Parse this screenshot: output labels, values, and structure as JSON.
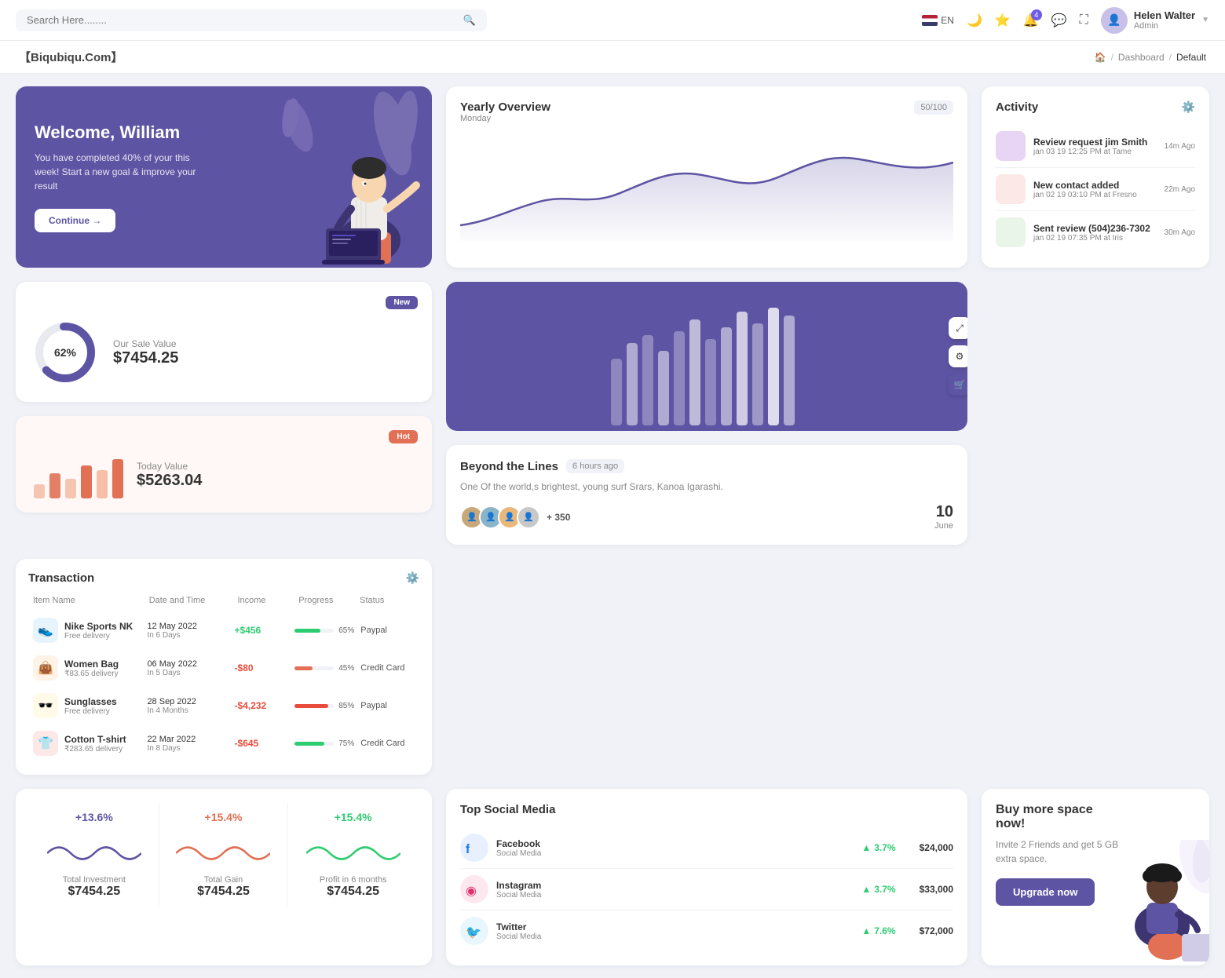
{
  "topnav": {
    "search_placeholder": "Search Here........",
    "lang": "EN",
    "notif_count": "4",
    "user_name": "Helen Walter",
    "user_role": "Admin"
  },
  "breadcrumb": {
    "brand": "【Biqubiqu.Com】",
    "home": "🏠",
    "dashboard": "Dashboard",
    "current": "Default"
  },
  "welcome": {
    "title": "Welcome, William",
    "subtitle": "You have completed 40% of your this week! Start a new goal & improve your result",
    "button": "Continue →"
  },
  "yearly": {
    "title": "Yearly Overview",
    "subtitle": "Monday",
    "badge": "50/100"
  },
  "activity": {
    "title": "Activity",
    "items": [
      {
        "title": "Review request jim Smith",
        "sub": "jan 03 19 12:25 PM at Tame",
        "time": "14m Ago",
        "color": "#e8d5f5"
      },
      {
        "title": "New contact added",
        "sub": "jan 02 19 03:10 PM at Fresno",
        "time": "22m Ago",
        "color": "#fde8e8"
      },
      {
        "title": "Sent review (504)236-7302",
        "sub": "jan 02 19 07:35 PM at Iris",
        "time": "30m Ago",
        "color": "#e8f5e8"
      }
    ]
  },
  "transaction": {
    "title": "Transaction",
    "headers": [
      "Item Name",
      "Date and Time",
      "Income",
      "Progress",
      "Status"
    ],
    "rows": [
      {
        "name": "Nike Sports NK",
        "sub": "Free delivery",
        "date": "12 May 2022",
        "days": "In 6 Days",
        "income": "+$456",
        "income_type": "pos",
        "progress": 65,
        "status": "Paypal",
        "icon": "👟",
        "icon_bg": "#e8f4fd",
        "bar_color": "#2ecc71"
      },
      {
        "name": "Women Bag",
        "sub": "₹83.65 delivery",
        "date": "06 May 2022",
        "days": "In 5 Days",
        "income": "-$80",
        "income_type": "neg",
        "progress": 45,
        "status": "Credit Card",
        "icon": "👜",
        "icon_bg": "#fff3e8",
        "bar_color": "#e17055"
      },
      {
        "name": "Sunglasses",
        "sub": "Free delivery",
        "date": "28 Sep 2022",
        "days": "In 4 Months",
        "income": "-$4,232",
        "income_type": "neg",
        "progress": 85,
        "status": "Paypal",
        "icon": "🕶️",
        "icon_bg": "#fffbe8",
        "bar_color": "#e74c3c"
      },
      {
        "name": "Cotton T-shirt",
        "sub": "₹283.65 delivery",
        "date": "22 Mar 2022",
        "days": "In 8 Days",
        "income": "-$645",
        "income_type": "neg",
        "progress": 75,
        "status": "Credit Card",
        "icon": "👕",
        "icon_bg": "#fde8e8",
        "bar_color": "#2ecc71"
      }
    ]
  },
  "sale_new": {
    "badge": "New",
    "label": "Our Sale Value",
    "value": "$7454.25",
    "donut_pct": 62,
    "donut_label": "62%"
  },
  "sale_hot": {
    "badge": "Hot",
    "label": "Today Value",
    "value": "$5263.04",
    "bars": [
      30,
      50,
      40,
      65,
      55,
      70
    ]
  },
  "beyond": {
    "title": "Beyond the Lines",
    "time": "6 hours ago",
    "desc": "One Of the world,s brightest, young surf Srars, Kanoa Igarashi.",
    "plus_count": "+ 350",
    "date_num": "10",
    "date_month": "June"
  },
  "stats": [
    {
      "percent": "+13.6%",
      "percent_color": "#5e54a4",
      "label": "Total Investment",
      "value": "$7454.25",
      "wave_color": "#5e54a4"
    },
    {
      "percent": "+15.4%",
      "percent_color": "#e17055",
      "label": "Total Gain",
      "value": "$7454.25",
      "wave_color": "#e17055"
    },
    {
      "percent": "+15.4%",
      "percent_color": "#2ecc71",
      "label": "Profit in 6 months",
      "value": "$7454.25",
      "wave_color": "#2ecc71"
    }
  ],
  "social": {
    "title": "Top Social Media",
    "items": [
      {
        "name": "Facebook",
        "sub": "Social Media",
        "growth": "3.7%",
        "amount": "$24,000",
        "color": "#1877f2",
        "icon": "f"
      },
      {
        "name": "Instagram",
        "sub": "Social Media",
        "growth": "3.7%",
        "amount": "$33,000",
        "color": "#e1306c",
        "icon": "in"
      },
      {
        "name": "Twitter",
        "sub": "Social Media",
        "growth": "7.6%",
        "amount": "$72,000",
        "color": "#1da1f2",
        "icon": "tw"
      }
    ]
  },
  "space": {
    "title": "Buy more space now!",
    "desc": "Invite 2 Friends and get 5 GB extra space.",
    "button": "Upgrade now"
  }
}
